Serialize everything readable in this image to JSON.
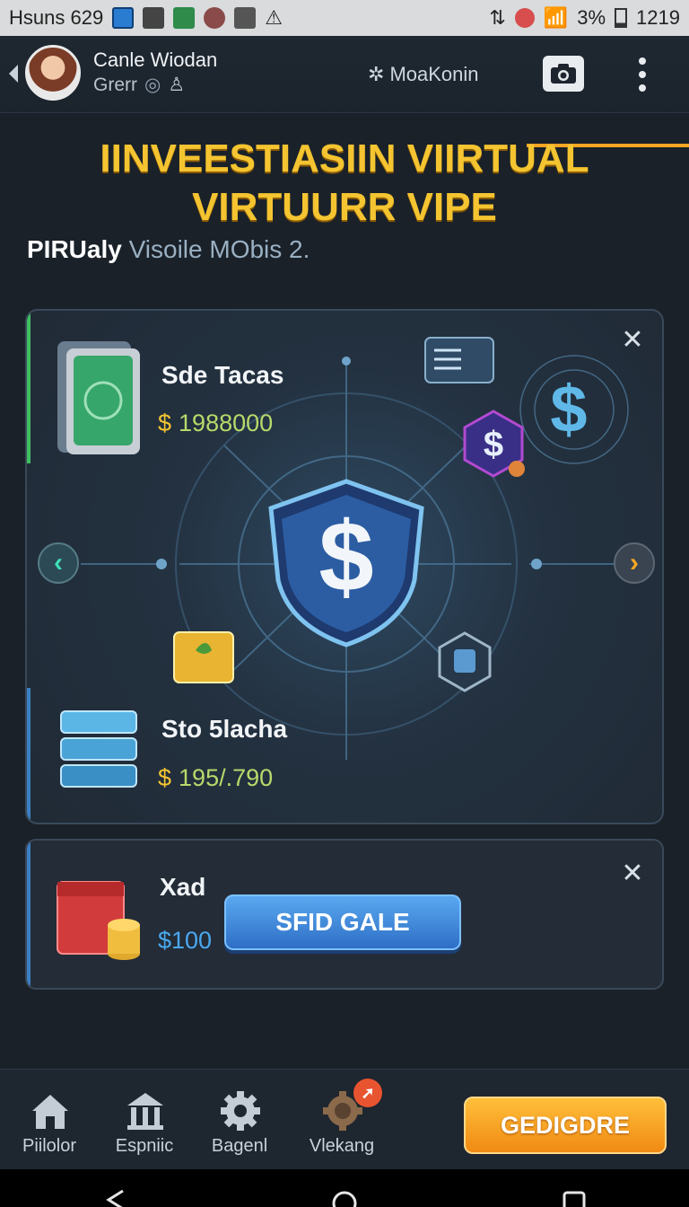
{
  "status_bar": {
    "carrier": "Hsuns 629",
    "battery": "3%",
    "time": "1219"
  },
  "app_bar": {
    "user_name": "Canle Wiodan",
    "user_sub": "Grerr",
    "center_label": "MoaKonin"
  },
  "hero": {
    "title_line1": "IINVEESTIASIIN VIIRTUAL",
    "title_line2": "VIRTUURR VIPE",
    "subtitle_bold": "PIRUaly",
    "subtitle_rest": " Visoile MObis 2."
  },
  "card_main": {
    "item1": {
      "name": "Sde Tacas",
      "currency": "$",
      "price": "1988000"
    },
    "item2": {
      "name": "Sto 5lacha",
      "currency": "$",
      "price": "195/.790"
    }
  },
  "card_second": {
    "name": "Xad",
    "price": "$100",
    "button": "SFID GALE"
  },
  "bottom_nav": {
    "items": [
      {
        "label": "Piilolor"
      },
      {
        "label": "Espniic"
      },
      {
        "label": "Bagenl"
      },
      {
        "label": "Vlekang"
      }
    ],
    "cta": "GEDIGDRE"
  },
  "colors": {
    "accent_orange": "#f5a623",
    "title_gold": "#f4c431",
    "button_blue": "#3b82d6",
    "badge_red": "#e8542f"
  }
}
